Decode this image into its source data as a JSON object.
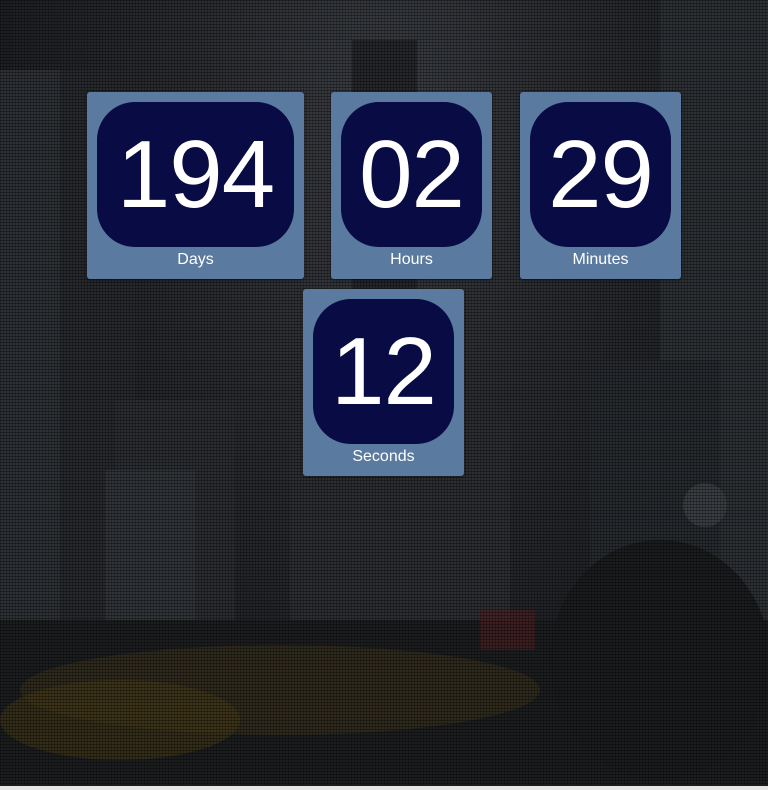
{
  "countdown": {
    "days": {
      "value": "194",
      "label": "Days"
    },
    "hours": {
      "value": "02",
      "label": "Hours"
    },
    "minutes": {
      "value": "29",
      "label": "Minutes"
    },
    "seconds": {
      "value": "12",
      "label": "Seconds"
    }
  },
  "colors": {
    "tile": "#5b7aa0",
    "number_box": "#080b44",
    "text": "#ffffff",
    "background": "#1e2023"
  }
}
